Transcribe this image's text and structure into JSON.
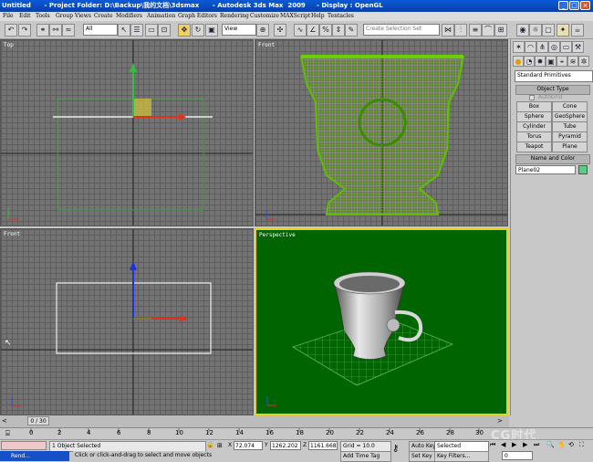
{
  "window": {
    "title": "Untitled      - Project Folder: D:\\Backup\\我的文档\\3dsmax      - Autodesk 3ds Max  2009     - Display : OpenGL",
    "controls": [
      "_",
      "□",
      "×"
    ]
  },
  "menu": [
    "File",
    "Edit",
    "Tools",
    "Group",
    "Views",
    "Create",
    "Modifiers",
    "Animation",
    "Graph Editors",
    "Rendering",
    "Customize",
    "MAXScript",
    "Help",
    "Tentacles"
  ],
  "toolbar": {
    "selection_filter": "All",
    "reference_coord": "View",
    "named_selection_placeholder": "Create Selection Set"
  },
  "viewports": {
    "top_left": {
      "label": "Top"
    },
    "top_right": {
      "label": "Front"
    },
    "bottom_left": {
      "label": "Front"
    },
    "bottom_right": {
      "label": "Perspective"
    }
  },
  "command_panel": {
    "category_dropdown": "Standard Primitives",
    "object_type_header": "Object Type",
    "autogrid_label": "AutoGrid",
    "buttons": [
      "Box",
      "Cone",
      "Sphere",
      "GeoSphere",
      "Cylinder",
      "Tube",
      "Torus",
      "Pyramid",
      "Teapot",
      "Plane"
    ],
    "name_color_header": "Name and Color",
    "object_name": "Plane02",
    "object_color": "#55d080"
  },
  "timeline": {
    "frame_counter": "0 / 30",
    "ticks": [
      "0",
      "2",
      "4",
      "6",
      "8",
      "10",
      "12",
      "14",
      "16",
      "18",
      "20",
      "22",
      "24",
      "26",
      "28",
      "30"
    ]
  },
  "status": {
    "selection_count": "1 Object Selected",
    "prompt": "Click or click-and-drag to select and move objects",
    "maxscript_listener": "Rend...",
    "x_label": "X",
    "x_value": "72.074",
    "y_label": "Y",
    "y_value": "1262.202",
    "z_label": "Z",
    "z_value": "1161.668",
    "grid": "Grid = 10.0",
    "add_time_tag": "Add Time Tag",
    "auto_key": "Auto Key",
    "set_key": "Set Key",
    "key_mode": "Selected",
    "key_filters": "Key Filters...",
    "current_frame": "0",
    "watermark": "CG时代"
  }
}
